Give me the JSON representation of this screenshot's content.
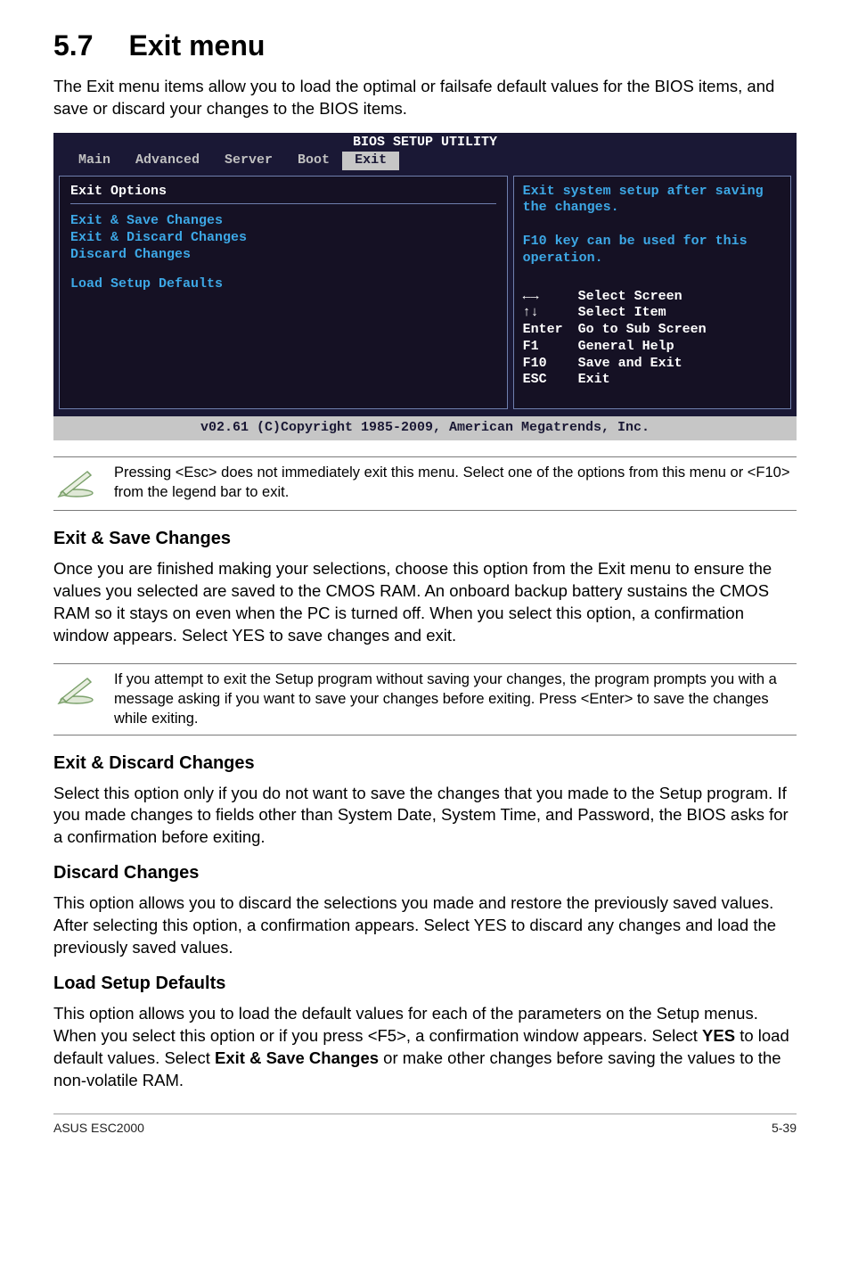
{
  "section": {
    "number": "5.7",
    "title": "Exit menu"
  },
  "intro": "The Exit menu items allow you to load the optimal or failsafe default values for the BIOS items, and save or discard your changes to the BIOS items.",
  "bios": {
    "title": "BIOS SETUP UTILITY",
    "tabs": [
      "Main",
      "Advanced",
      "Server",
      "Boot",
      "Exit"
    ],
    "selected_tab_index": 4,
    "options_label": "Exit Options",
    "options": [
      "Exit & Save Changes",
      "Exit & Discard Changes",
      "Discard Changes",
      "Load Setup Defaults"
    ],
    "help_lines": "Exit system setup after saving the changes.\n\nF10 key can be used for this operation.",
    "legend": [
      {
        "key": "←→",
        "val": "Select Screen"
      },
      {
        "key": "↑↓",
        "val": "Select Item"
      },
      {
        "key": "Enter",
        "val": "Go to Sub Screen"
      },
      {
        "key": "F1",
        "val": "General Help"
      },
      {
        "key": "F10",
        "val": "Save and Exit"
      },
      {
        "key": "ESC",
        "val": "Exit"
      }
    ],
    "footer": "v02.61 (C)Copyright 1985-2009, American Megatrends, Inc."
  },
  "note1": "Pressing <Esc> does not immediately exit this menu. Select one of the options from this menu or <F10> from the legend bar to exit.",
  "sections": {
    "save": {
      "heading": "Exit & Save Changes",
      "body": "Once you are finished making your selections, choose this option from the Exit menu to ensure the values you selected are saved to the CMOS RAM. An onboard backup battery sustains the CMOS RAM so it stays on even when the PC is turned off. When you select this option, a confirmation window appears. Select YES to save changes and exit."
    },
    "note2": "If you attempt to exit the Setup program without saving your changes, the program prompts you with a message asking if you want to save your changes before exiting. Press <Enter> to save the changes while exiting.",
    "discard_exit": {
      "heading": "Exit & Discard Changes",
      "body": "Select this option only if you do not want to save the changes that you made to the Setup program. If you made changes to fields other than System Date, System Time, and Password, the BIOS asks for a confirmation before exiting."
    },
    "discard": {
      "heading": "Discard Changes",
      "body": "This option allows you to discard the selections you made and restore the previously saved values. After selecting this option, a confirmation appears. Select YES to discard any changes and load the previously saved values."
    },
    "defaults": {
      "heading": "Load Setup Defaults",
      "body_pre": "This option allows you to load the default values for each of the parameters on the Setup menus. When you select this option or if you press <F5>, a confirmation window appears. Select ",
      "bold1": "YES",
      "mid": " to load default values. Select ",
      "bold2": "Exit & Save Changes",
      "tail": " or make other changes before saving the values to the non-volatile RAM."
    }
  },
  "page_footer": {
    "left": "ASUS ESC2000",
    "right": "5-39"
  }
}
